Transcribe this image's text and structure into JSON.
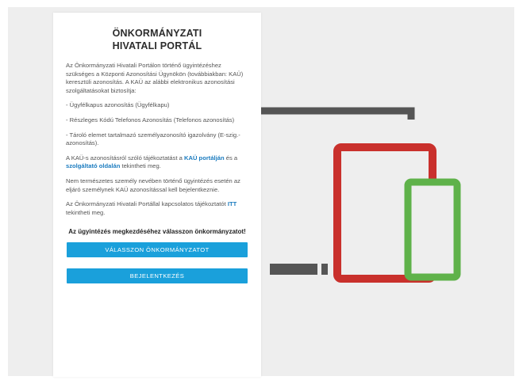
{
  "portal": {
    "title_line1": "ÖNKORMÁNYZATI",
    "title_line2": "HIVATALI PORTÁL",
    "intro": "Az Önkormányzati Hivatali Portálon történő ügyintézéshez szükséges a Központi Azonosítási Ügynökön (továbbiakban: KAÜ) keresztüli azonosítás. A KAÜ az alábbi elektronikus azonosítási szolgáltatásokat biztosítja:",
    "bullets": [
      "- Ügyfélkapus azonosítás (Ügyfélkapu)",
      "- Részleges Kódú Telefonos Azonosítás (Telefonos azonosítás)",
      "- Tároló elemet tartalmazó személyazonosító igazolvány (E-szig.-azonosítás)."
    ],
    "kau_info": {
      "pre": "A KAÜ-s azonosításról szóló tájékoztatást a ",
      "link1": "KAÜ portálján",
      "mid": " és a ",
      "link2": "szolgáltató oldalán",
      "post": " tekintheti meg."
    },
    "non_personal": "Nem természetes személy nevében történő ügyintézés esetén az eljáró személynek KAÜ azonosítással kell bejelentkeznie.",
    "contact_info": {
      "pre": "Az Önkormányzati Hivatali Portállal kapcsolatos tájékoztatót ",
      "link": "ITT",
      "post": " tekintheti meg."
    },
    "cta": "Az ügyintézés megkezdéséhez válasszon önkormányzatot!",
    "button_select": "VÁLASSZON ÖNKORMÁNYZATOT",
    "button_login": "BEJELENTKEZÉS"
  },
  "colors": {
    "accent": "#1aa0db",
    "link": "#1a7bbf",
    "laptop": "#555555",
    "tablet": "#c9302c",
    "phone": "#5fb24a",
    "background": "#eeeeee"
  },
  "illustration": {
    "icons": [
      "laptop-icon",
      "tablet-icon",
      "phone-icon"
    ]
  }
}
